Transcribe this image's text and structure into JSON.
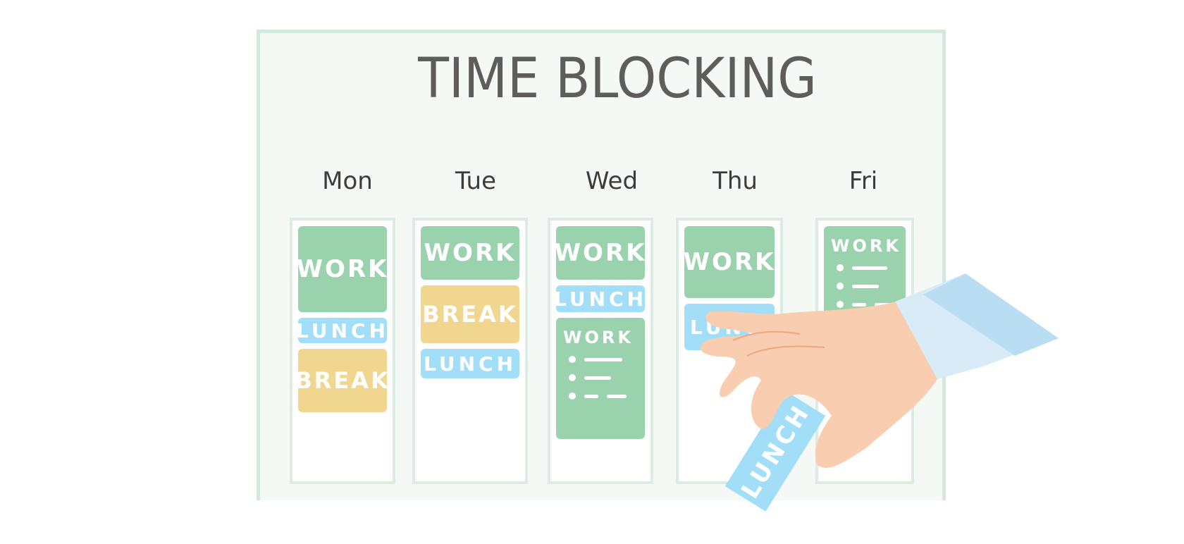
{
  "title": "TIME BLOCKING",
  "days": [
    {
      "label": "Mon",
      "blocks": [
        {
          "type": "work",
          "label": "WORK"
        },
        {
          "type": "lunch",
          "label": "LUNCH"
        },
        {
          "type": "break",
          "label": "BREAK"
        }
      ]
    },
    {
      "label": "Tue",
      "blocks": [
        {
          "type": "work",
          "label": "WORK"
        },
        {
          "type": "break",
          "label": "BREAK"
        },
        {
          "type": "lunch",
          "label": "LUNCH"
        }
      ]
    },
    {
      "label": "Wed",
      "blocks": [
        {
          "type": "work",
          "label": "WORK"
        },
        {
          "type": "lunch",
          "label": "LUNCH"
        },
        {
          "type": "work",
          "label": "WORK"
        }
      ]
    },
    {
      "label": "Thu",
      "blocks": [
        {
          "type": "work",
          "label": "WORK"
        },
        {
          "type": "lunch",
          "label": "LUNCH"
        }
      ]
    },
    {
      "label": "Fri",
      "blocks": [
        {
          "type": "work",
          "label": "WORK"
        }
      ]
    }
  ],
  "held_card": {
    "label": "LUNCH"
  },
  "colors": {
    "work": "#9bd2ae",
    "lunch": "#a2def8",
    "break": "#f1d690",
    "skin": "#f9cdb0",
    "sleeve": "#b9def3"
  }
}
